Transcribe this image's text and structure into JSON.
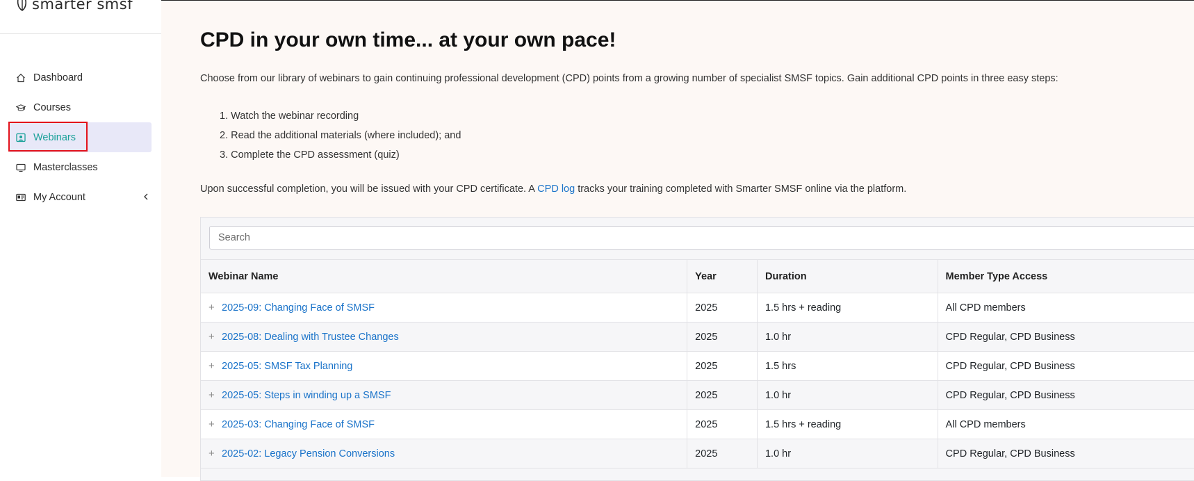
{
  "brand": {
    "name": "smarter smsf"
  },
  "sidebar": {
    "items": [
      {
        "label": "Dashboard",
        "icon": "home-icon"
      },
      {
        "label": "Courses",
        "icon": "graduation-cap-icon"
      },
      {
        "label": "Webinars",
        "icon": "webinar-icon",
        "active": true
      },
      {
        "label": "Masterclasses",
        "icon": "monitor-icon"
      },
      {
        "label": "My Account",
        "icon": "id-card-icon",
        "has_submenu": true
      }
    ]
  },
  "main": {
    "title": "CPD in your own time... at your own pace!",
    "intro": "Choose from our library of webinars to gain continuing professional development (CPD) points from a growing number of specialist SMSF topics.  Gain additional CPD points in three easy steps:",
    "steps": [
      "1. Watch the webinar recording",
      "2. Read the additional materials (where included); and",
      "3. Complete the CPD assessment (quiz)"
    ],
    "completion_before": "Upon successful completion, you will be issued with your CPD certificate.  A ",
    "completion_link": "CPD log",
    "completion_after": " tracks your training completed with Smarter SMSF online via the platform."
  },
  "table": {
    "search_placeholder": "Search",
    "columns": [
      "Webinar Name",
      "Year",
      "Duration",
      "Member Type Access"
    ],
    "rows": [
      {
        "name": "2025-09: Changing Face of SMSF",
        "year": "2025",
        "duration": "1.5 hrs + reading",
        "access": "All CPD members"
      },
      {
        "name": "2025-08: Dealing with Trustee Changes",
        "year": "2025",
        "duration": "1.0 hr",
        "access": "CPD Regular, CPD Business"
      },
      {
        "name": "2025-05: SMSF Tax Planning",
        "year": "2025",
        "duration": "1.5 hrs",
        "access": "CPD Regular, CPD Business"
      },
      {
        "name": "2025-05: Steps in winding up a SMSF",
        "year": "2025",
        "duration": "1.0 hr",
        "access": "CPD Regular, CPD Business"
      },
      {
        "name": "2025-03: Changing Face of SMSF",
        "year": "2025",
        "duration": "1.5 hrs + reading",
        "access": "All CPD members"
      },
      {
        "name": "2025-02: Legacy Pension Conversions",
        "year": "2025",
        "duration": "1.0 hr",
        "access": "CPD Regular, CPD Business"
      }
    ]
  },
  "colors": {
    "accent": "#1aa199",
    "link": "#1a73c9",
    "active_bg": "#e8e8f8",
    "main_bg": "#fdf8f5",
    "highlight": "#e3121b"
  }
}
